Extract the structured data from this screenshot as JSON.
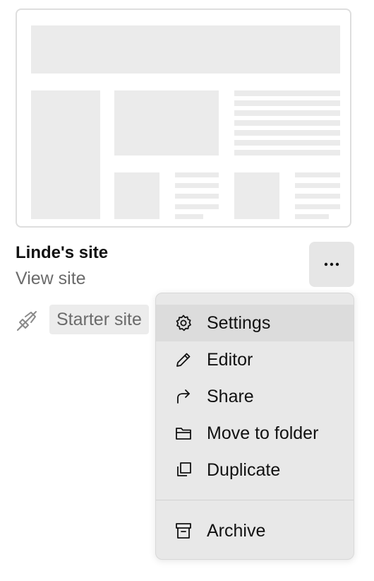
{
  "card": {
    "title": "Linde's site",
    "view_link": "View site",
    "badge": "Starter site",
    "status_icon": "unpublished-icon"
  },
  "more_button": {
    "label": "...",
    "icon": "more-icon"
  },
  "menu": {
    "items": [
      {
        "label": "Settings",
        "icon": "gear-icon"
      },
      {
        "label": "Editor",
        "icon": "pencil-icon"
      },
      {
        "label": "Share",
        "icon": "share-arrow-icon"
      },
      {
        "label": "Move to folder",
        "icon": "folder-icon"
      },
      {
        "label": "Duplicate",
        "icon": "duplicate-icon"
      },
      {
        "label": "Archive",
        "icon": "archive-icon"
      }
    ],
    "highlighted_item": "Settings"
  },
  "colors": {
    "menu_background": "#e8e8e8",
    "menu_highlight": "#dcdcdc",
    "placeholder": "#ebebeb",
    "muted_text": "#6b6b6b"
  }
}
